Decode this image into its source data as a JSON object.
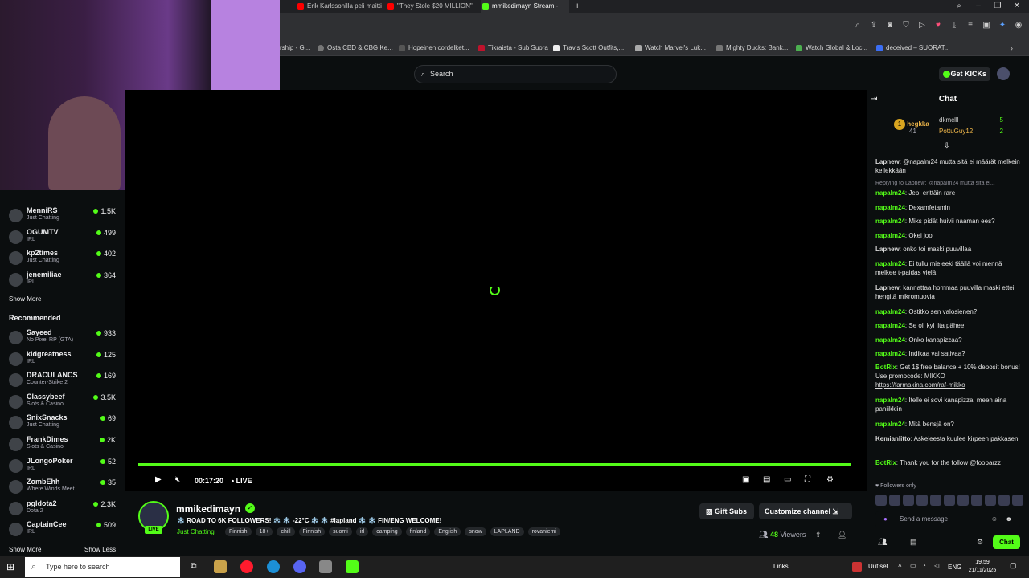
{
  "browser": {
    "tabs": [
      {
        "label": "Erik Karlssonilla peli maitti",
        "color": "#ff0000"
      },
      {
        "label": "\"They Stole $20 MILLION\"",
        "color": "#ff0000"
      },
      {
        "label": "mmikedimayn Stream - ·",
        "color": "#53fc18"
      }
    ],
    "bookmarks": [
      "rship - G...",
      "Osta CBD & CBG Ke...",
      "Hopeinen cordelket...",
      "Tikraista - Sub Suora",
      "Travis Scott Outfits,...",
      "Watch Marvel's Luk...",
      "Mighty Ducks: Bank...",
      "Watch Global & Loc...",
      "deceived – SUORAT..."
    ]
  },
  "header": {
    "search_placeholder": "Search",
    "get_kicks_label": "Get KICKs"
  },
  "sidebar": {
    "following": [
      {
        "name": "MenniRS",
        "category": "Just Chatting",
        "viewers": "1.5K"
      },
      {
        "name": "OGUMTV",
        "category": "IRL",
        "viewers": "499"
      },
      {
        "name": "kp2times",
        "category": "Just Chatting",
        "viewers": "402"
      },
      {
        "name": "jenemiliae",
        "category": "IRL",
        "viewers": "364"
      }
    ],
    "show_more_label": "Show More",
    "recommended_title": "Recommended",
    "recommended": [
      {
        "name": "Sayeed",
        "category": "No Pixel RP (GTA)",
        "viewers": "933"
      },
      {
        "name": "kidgreatness",
        "category": "IRL",
        "viewers": "125"
      },
      {
        "name": "DRACULANCS",
        "category": "Counter-Strike 2",
        "viewers": "169"
      },
      {
        "name": "Classybeef",
        "category": "Slots & Casino",
        "viewers": "3.5K"
      },
      {
        "name": "SnixSnacks",
        "category": "Just Chatting",
        "viewers": "69"
      },
      {
        "name": "FrankDimes",
        "category": "Slots & Casino",
        "viewers": "2K"
      },
      {
        "name": "JLongoPoker",
        "category": "IRL",
        "viewers": "52"
      },
      {
        "name": "ZombEhh",
        "category": "Where Winds Meet",
        "viewers": "35"
      },
      {
        "name": "pgldota2",
        "category": "Dota 2",
        "viewers": "2.3K"
      },
      {
        "name": "CaptainCee",
        "category": "IRL",
        "viewers": "509"
      }
    ],
    "show_more_bottom": "Show More",
    "show_less_label": "Show Less"
  },
  "player": {
    "time": "00:17:20",
    "live_label": "LIVE",
    "progress": 1.0
  },
  "stream": {
    "live_badge": "LIVE",
    "channel_name": "mmikedimayn",
    "title": "❄️ ROAD TO 6K FOLLOWERS! ❄️ ❄️ -22°C ❄️ ❄️ #lapland ❄️ ❄️ FIN/ENG WELCOME!",
    "category": "Just Chatting",
    "tags": [
      "Finnish",
      "18+",
      "chill",
      "Finnish",
      "suomi",
      "irl",
      "camping",
      "finland",
      "English",
      "snow",
      "LAPLAND",
      "rovaniemi"
    ],
    "gift_subs_label": "Gift Subs",
    "customize_label": "Customize channel",
    "viewers_count": "48",
    "viewers_label": "Viewers"
  },
  "chat": {
    "title": "Chat",
    "top_gifters": [
      {
        "name": "hegkka",
        "count": "41"
      },
      {
        "name": "dkmclll",
        "count": "5"
      },
      {
        "name": "PottuGuy12",
        "count": "2"
      }
    ],
    "reply_note": "Replying to Lapnew: @napalm24 mutta sitä ei...",
    "messages": [
      {
        "user": "Lapnew",
        "text": "@napalm24 mutta sitä ei määrät melkein kellekkään",
        "green": false
      },
      {
        "user": "napalm24",
        "text": "Jep, erittäin rare",
        "green": true
      },
      {
        "user": "napalm24",
        "text": "Dexamfetamin",
        "green": true
      },
      {
        "user": "napalm24",
        "text": "Miks pidät huivii naaman ees?",
        "green": true
      },
      {
        "user": "napalm24",
        "text": "Okei joo",
        "green": true
      },
      {
        "user": "Lapnew",
        "text": "onko toi maski puuvillaa",
        "green": false
      },
      {
        "user": "napalm24",
        "text": "Ei tullu mieleeki täällä voi mennä melkee t-paidas vielä",
        "green": true
      },
      {
        "user": "Lapnew",
        "text": "kannattaa hommaa puuvilla maski ettei hengitä mikromuovia",
        "green": false
      },
      {
        "user": "napalm24",
        "text": "Ostitko sen valosienen?",
        "green": true
      },
      {
        "user": "napalm24",
        "text": "Se oli kyl ilta pähee",
        "green": true
      },
      {
        "user": "napalm24",
        "text": "Onko kanapizzaa?",
        "green": true
      },
      {
        "user": "napalm24",
        "text": "Indikaa vai sativaa?",
        "green": true
      },
      {
        "user": "BotRix",
        "text": "Get 1$ free balance + 10% deposit bonus! Use promocode: MIKKO",
        "green": true,
        "link": "https://farmakina.com/raf-mikko"
      },
      {
        "user": "napalm24",
        "text": "Itelle ei sovi kanapizza, meen aina paniikkiin",
        "green": true
      },
      {
        "user": "napalm24",
        "text": "Mitä bensjä on?",
        "green": true
      },
      {
        "user": "Kemianlitto",
        "text": "Askeleesta kuulee kirpeen pakkasen",
        "green": false
      },
      {
        "user": "BotRix",
        "text": "Thank you for the follow @foobarzz",
        "green": true
      }
    ],
    "followers_only": "Followers only",
    "input_placeholder": "Send a message",
    "send_label": "Chat"
  },
  "taskbar": {
    "search_placeholder": "Type here to search",
    "links_label": "Links",
    "news_label": "Uutiset",
    "lang": "ENG",
    "time": "19.59",
    "date": "21/11/2025"
  }
}
